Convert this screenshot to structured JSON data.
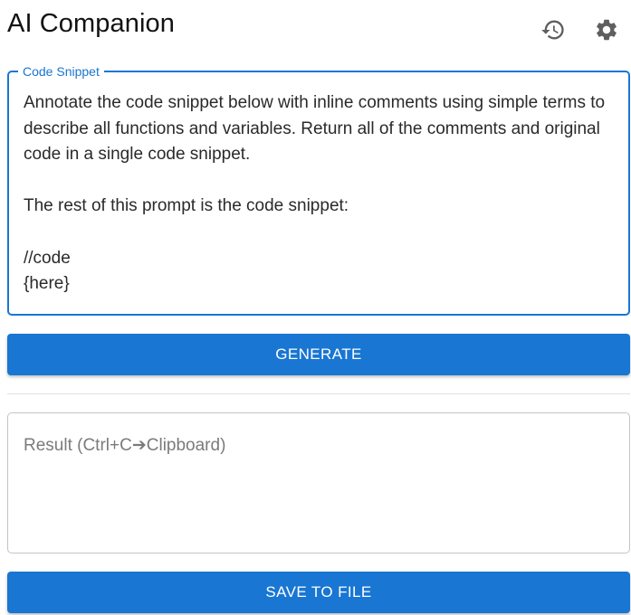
{
  "header": {
    "title": "AI Companion",
    "history_icon": "history-icon",
    "settings_icon": "gear-icon"
  },
  "snippet": {
    "label": "Code Snippet",
    "value": "Annotate the code snippet below with inline comments using simple terms to describe all functions and variables. Return all of the comments and original code in a single code snippet.\n\nThe rest of this prompt is the code snippet:\n\n//code\n{here}"
  },
  "generate_button": {
    "label": "GENERATE"
  },
  "result": {
    "placeholder": "Result (Ctrl+C➔Clipboard)",
    "value": ""
  },
  "save_button": {
    "label": "SAVE TO FILE"
  },
  "colors": {
    "primary": "#1976d2",
    "icon": "#5f5f5f",
    "outline": "#c4c4c4"
  }
}
